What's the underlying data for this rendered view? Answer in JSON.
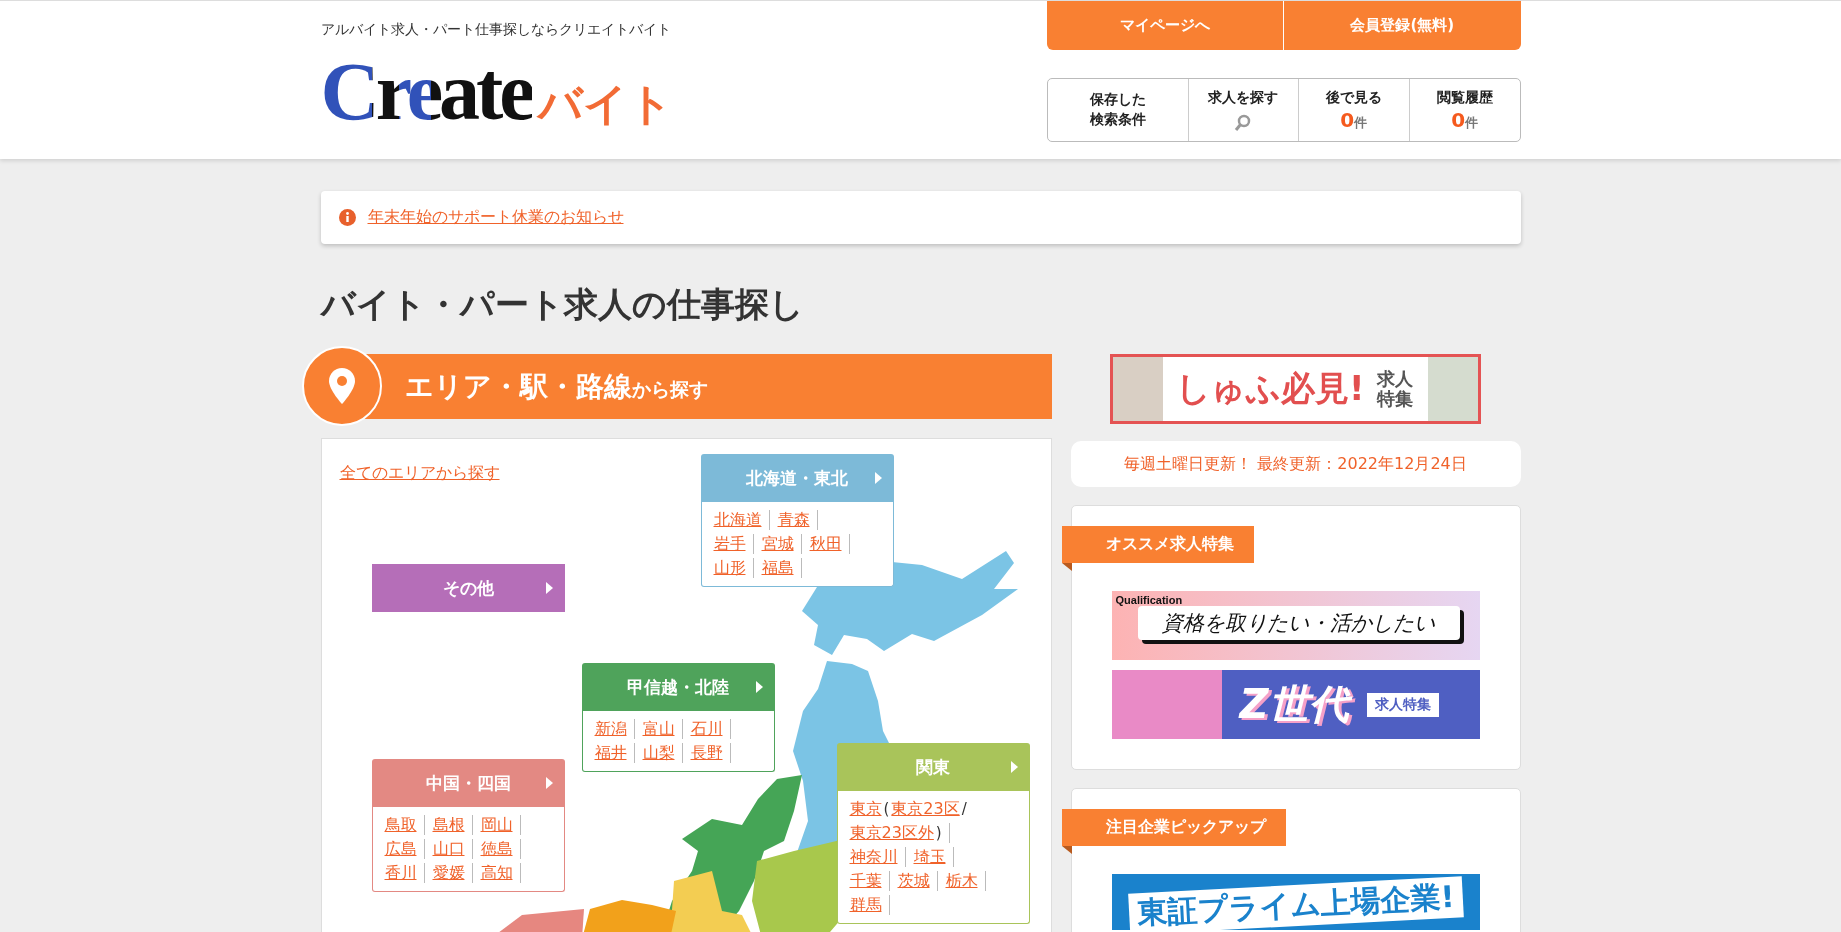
{
  "header": {
    "tagline": "アルバイト求人・パート仕事探しならクリエイトバイト",
    "logo": {
      "main": "Create",
      "sub": "バイト"
    },
    "top_buttons": [
      "マイページへ",
      "会員登録(無料)"
    ],
    "nav": [
      {
        "kind": "plain",
        "label": "保存した検索条件"
      },
      {
        "kind": "search",
        "label": "求人を探す"
      },
      {
        "kind": "count",
        "label": "後で見る",
        "count": "0",
        "unit": "件"
      },
      {
        "kind": "count",
        "label": "閲覧履歴",
        "count": "0",
        "unit": "件"
      }
    ]
  },
  "notice": {
    "text": "年末年始のサポート休業のお知らせ"
  },
  "page_title": "バイト・パート求人の仕事探し",
  "area_section": {
    "title_main": "エリア・駅・路線",
    "title_sub": "から探す",
    "all_link": "全てのエリアから探す",
    "regions": [
      {
        "name": "北海道・東北",
        "color": "#7dbad8",
        "prefectures": [
          {
            "name": "北海道",
            "kind": "link"
          },
          {
            "name": "青森",
            "kind": "link"
          },
          {
            "name": "岩手",
            "kind": "link"
          },
          {
            "name": "宮城",
            "kind": "link"
          },
          {
            "name": "秋田",
            "kind": "link"
          },
          {
            "name": "山形",
            "kind": "link"
          },
          {
            "name": "福島",
            "kind": "link"
          }
        ]
      },
      {
        "name": "その他",
        "color": "#b56eb8"
      },
      {
        "name": "甲信越・北陸",
        "color": "#4fa35b",
        "prefectures": [
          {
            "name": "新潟",
            "kind": "link"
          },
          {
            "name": "富山",
            "kind": "link"
          },
          {
            "name": "石川",
            "kind": "link"
          },
          {
            "name": "福井",
            "kind": "link"
          },
          {
            "name": "山梨",
            "kind": "link"
          },
          {
            "name": "長野",
            "kind": "link"
          }
        ]
      },
      {
        "name": "中国・四国",
        "color": "#e38983",
        "prefectures": [
          {
            "name": "鳥取",
            "kind": "link"
          },
          {
            "name": "島根",
            "kind": "link"
          },
          {
            "name": "岡山",
            "kind": "link"
          },
          {
            "name": "広島",
            "kind": "link"
          },
          {
            "name": "山口",
            "kind": "link"
          },
          {
            "name": "徳島",
            "kind": "link"
          },
          {
            "name": "香川",
            "kind": "link"
          },
          {
            "name": "愛媛",
            "kind": "link"
          },
          {
            "name": "高知",
            "kind": "link"
          }
        ]
      },
      {
        "name": "関東",
        "color": "#a9c45a",
        "prefectures": [
          {
            "name": "東京",
            "kind": "link"
          },
          {
            "name": "(",
            "kind": "open"
          },
          {
            "name": "東京23区",
            "kind": "link"
          },
          {
            "name": "/",
            "kind": "slash"
          },
          {
            "name": "東京23区外",
            "kind": "link"
          },
          {
            "name": ")",
            "kind": "close"
          },
          {
            "name": "神奈川",
            "kind": "link"
          },
          {
            "name": "埼玉",
            "kind": "link"
          },
          {
            "name": "千葉",
            "kind": "link"
          },
          {
            "name": "茨城",
            "kind": "link"
          },
          {
            "name": "栃木",
            "kind": "link"
          },
          {
            "name": "群馬",
            "kind": "link"
          }
        ]
      }
    ]
  },
  "side": {
    "promo": {
      "headline": "しゅふ必見!",
      "tag": "求人特集"
    },
    "update_note": "毎週土曜日更新！ 最終更新：2022年12月24日",
    "cards": [
      {
        "title": "オススメ求人特集",
        "banners": [
          {
            "kind": "qualification",
            "label": "Qualification",
            "text": "資格を取りたい・活かしたい"
          },
          {
            "kind": "genz",
            "text": "Z世代",
            "tag": "求人特集"
          }
        ]
      },
      {
        "title": "注目企業ピックアップ",
        "banners": [
          {
            "kind": "prime",
            "text": "東証プライム上場企業!"
          }
        ]
      }
    ]
  }
}
